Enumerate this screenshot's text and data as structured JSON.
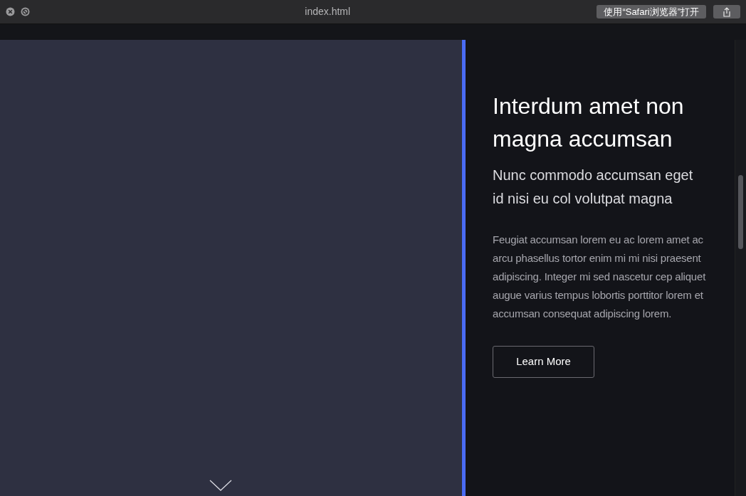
{
  "window": {
    "title": "index.html",
    "open_in_safari": "使用“Safari浏览器”打开"
  },
  "banner": {
    "heading": "Interdum amet non magna accumsan",
    "subheading": "Nunc commodo accumsan eget id nisi eu col volutpat magna",
    "body": "Feugiat accumsan lorem eu ac lorem amet ac arcu phasellus tortor enim mi mi nisi praesent adipiscing. Integer mi sed nascetur cep aliquet augue varius tempus lobortis porttitor lorem et accumsan consequat adipiscing lorem.",
    "button": "Learn More"
  }
}
